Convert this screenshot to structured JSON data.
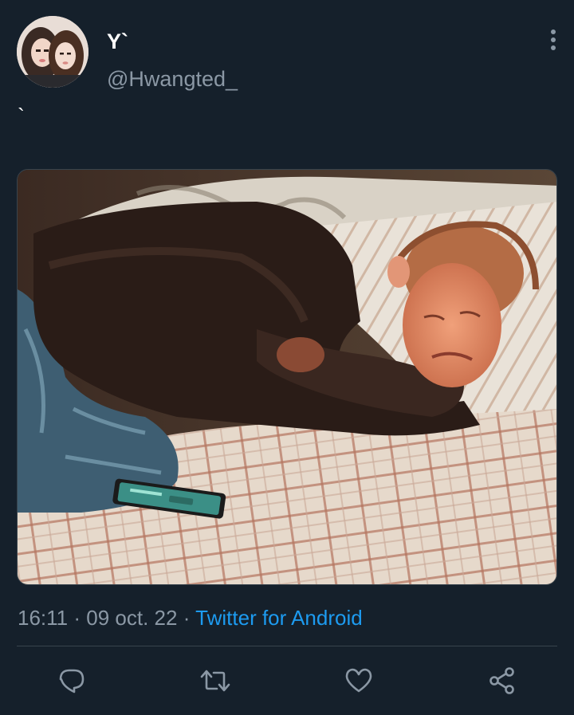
{
  "author": {
    "display_name": "Y`",
    "handle": "@Hwangted_",
    "avatar_icon": "avatar-photo"
  },
  "tweet": {
    "text": "`",
    "media_icon": "tweet-photo"
  },
  "meta": {
    "time": "16:11",
    "separator1": "·",
    "date": "09 oct. 22",
    "separator2": "·",
    "source": "Twitter for Android"
  },
  "actions": {
    "reply_icon": "reply-icon",
    "retweet_icon": "retweet-icon",
    "like_icon": "like-icon",
    "share_icon": "share-icon"
  },
  "colors": {
    "background": "#15202b",
    "secondary_text": "#8b98a5",
    "accent": "#1d9bf0",
    "divider": "#38444d"
  }
}
